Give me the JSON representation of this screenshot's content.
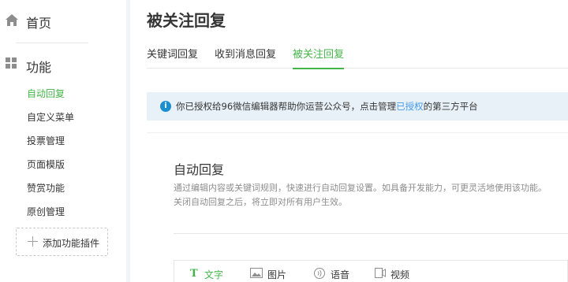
{
  "sidebar": {
    "home_label": "首页",
    "section_label": "功能",
    "items": [
      {
        "label": "自动回复",
        "active": true
      },
      {
        "label": "自定义菜单",
        "active": false
      },
      {
        "label": "投票管理",
        "active": false
      },
      {
        "label": "页面模版",
        "active": false
      },
      {
        "label": "赞赏功能",
        "active": false
      },
      {
        "label": "原创管理",
        "active": false
      }
    ],
    "add_plugin_label": "添加功能插件"
  },
  "main": {
    "title": "被关注回复",
    "tabs": [
      {
        "label": "关键词回复",
        "active": false
      },
      {
        "label": "收到消息回复",
        "active": false
      },
      {
        "label": "被关注回复",
        "active": true
      }
    ],
    "notice": {
      "prefix": "你已授权给96微信编辑器帮助你运营公众号，点击管理",
      "link": "已授权",
      "suffix": "的第三方平台"
    },
    "panel": {
      "title": "自动回复",
      "desc_line1": "通过编辑内容或关键词规则，快速进行自动回复设置。如具备开发能力，可更灵活地使用该功能。",
      "desc_line2": "关闭自动回复之后，将立即对所有用户生效。"
    },
    "editor_tools": [
      {
        "label": "文字",
        "icon": "text-icon",
        "active": true
      },
      {
        "label": "图片",
        "icon": "image-icon",
        "active": false
      },
      {
        "label": "语音",
        "icon": "voice-icon",
        "active": false
      },
      {
        "label": "视频",
        "icon": "video-icon",
        "active": false
      }
    ]
  },
  "colors": {
    "accent": "#44b549",
    "link": "#459ae9",
    "notice_bg": "#e8f1f8",
    "info": "#1b8ed0"
  }
}
